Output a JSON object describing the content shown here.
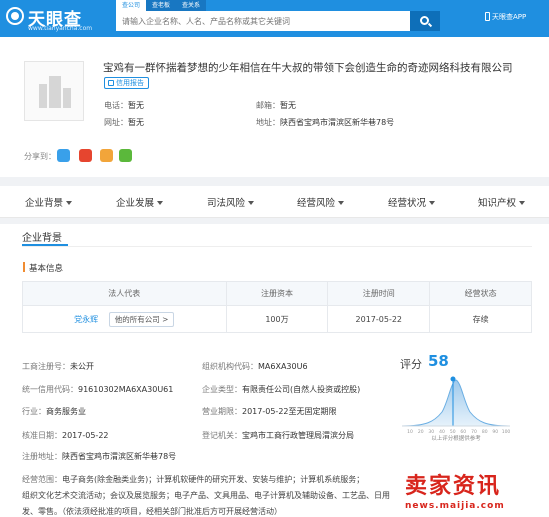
{
  "header": {
    "logo_text": "天眼查",
    "logo_sub": "www.tianyancha.com",
    "search_tabs": [
      "查公司",
      "查老板",
      "查关系"
    ],
    "search_placeholder": "请输入企业名称、人名、产品名称或其它关键词",
    "app_label": "天眼查APP"
  },
  "company": {
    "name": "宝鸡有一群怀揣着梦想的少年相信在牛大叔的带领下会创造生命的奇迹网络科技有限公司",
    "badge": "信用报告",
    "phone_label": "电话：",
    "phone": "暂无",
    "email_label": "邮箱：",
    "email": "暂无",
    "website_label": "网址：",
    "website": "暂无",
    "address_label": "地址：",
    "address": "陕西省宝鸡市渭滨区新华巷78号",
    "share_label": "分享到："
  },
  "nav": {
    "items": [
      "企业背景",
      "企业发展",
      "司法风险",
      "经营风险",
      "经营状况",
      "知识产权"
    ]
  },
  "section": {
    "title": "企业背景",
    "subtitle": "基本信息"
  },
  "registration": {
    "headers": [
      "法人代表",
      "注册资本",
      "注册时间",
      "经营状态"
    ],
    "legal_rep": "党永辉",
    "all_companies": "他的所有公司 >",
    "capital": "100万",
    "reg_date": "2017-05-22",
    "status": "存续"
  },
  "details": {
    "reg_no_label": "工商注册号：",
    "reg_no": "未公开",
    "org_code_label": "组织机构代码：",
    "org_code": "MA6XA30U6",
    "credit_code_label": "统一信用代码：",
    "credit_code": "91610302MA6XA30U61",
    "type_label": "企业类型：",
    "type": "有限责任公司(自然人投资或控股)",
    "industry_label": "行业：",
    "industry": "商务服务业",
    "term_label": "营业期限：",
    "term": "2017-05-22至无固定期限",
    "approve_label": "核准日期：",
    "approve": "2017-05-22",
    "authority_label": "登记机关：",
    "authority": "宝鸡市工商行政管理局渭滨分局",
    "reg_addr_label": "注册地址：",
    "reg_addr": "陕西省宝鸡市渭滨区新华巷78号"
  },
  "score": {
    "label": "评分",
    "value": "58",
    "axis_labels": [
      "10",
      "20",
      "30",
      "40",
      "50",
      "60",
      "70",
      "80",
      "90",
      "100"
    ],
    "caption": "以上评分根据供参考"
  },
  "scope": {
    "label": "经营范围：",
    "line1": "电子商务(除金融类业务)；计算机软硬件的研究开发、安装与维护；计算机系统服务；",
    "line2": "组织文化艺术交流活动；会议及展览服务；电子产品、文具用品、电子计算机及辅助设备、工艺品、日用",
    "line3": "发、零售。（依法须经批准的项目，经相关部门批准后方可开展经营活动）"
  },
  "watermark": {
    "main": "卖家资讯",
    "sub": "news.maijia.com"
  },
  "colors": {
    "brand_blue": "#1f8fe0",
    "accent_orange": "#f08c32",
    "watermark_red": "#d8251c"
  }
}
